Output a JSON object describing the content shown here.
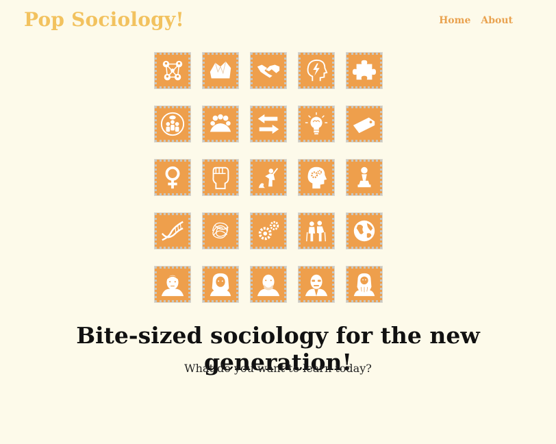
{
  "header": {
    "site_title": "Pop Sociology!",
    "nav": [
      {
        "label": "Home"
      },
      {
        "label": "About"
      }
    ]
  },
  "stamps": [
    {
      "icon": "social-network-icon"
    },
    {
      "icon": "crumpled-paper-icon"
    },
    {
      "icon": "handshake-icon"
    },
    {
      "icon": "head-lightning-icon"
    },
    {
      "icon": "puzzle-piece-icon"
    },
    {
      "icon": "group-discussion-icon"
    },
    {
      "icon": "crowd-icon"
    },
    {
      "icon": "exchange-arrows-icon"
    },
    {
      "icon": "lightbulb-brain-icon"
    },
    {
      "icon": "price-tag-icon"
    },
    {
      "icon": "venus-symbol-icon"
    },
    {
      "icon": "raised-fist-icon"
    },
    {
      "icon": "protest-figure-icon"
    },
    {
      "icon": "head-gears-icon"
    },
    {
      "icon": "chess-pawn-icon"
    },
    {
      "icon": "dna-helix-icon"
    },
    {
      "icon": "tangled-yarn-icon"
    },
    {
      "icon": "gears-icon"
    },
    {
      "icon": "elderly-couple-icon"
    },
    {
      "icon": "globe-icon"
    },
    {
      "icon": "portrait-sociologist-1-icon"
    },
    {
      "icon": "portrait-sociologist-2-icon"
    },
    {
      "icon": "portrait-sociologist-3-icon"
    },
    {
      "icon": "portrait-sociologist-4-icon"
    },
    {
      "icon": "portrait-sociologist-5-icon"
    }
  ],
  "hero": {
    "headline": "Bite-sized sociology for the new generation!",
    "subline": "What do you want to learn today?"
  },
  "colors": {
    "background": "#fdfaea",
    "brand": "#f2c25f",
    "nav": "#e9a24f",
    "stamp": "#ee9f4c"
  }
}
